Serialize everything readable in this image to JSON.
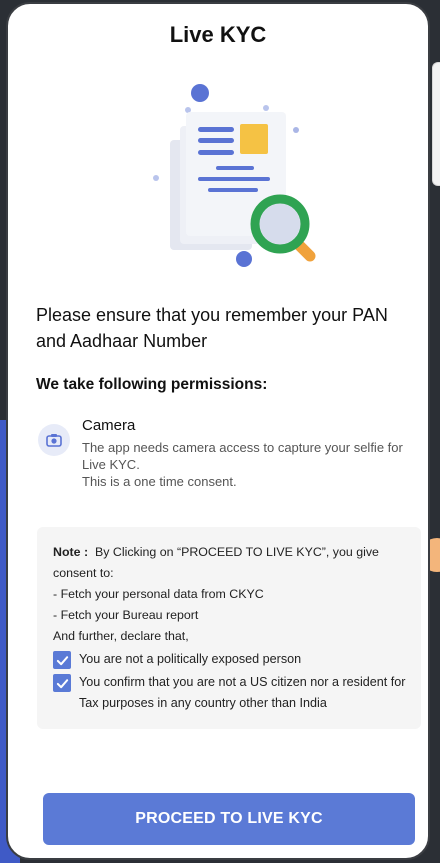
{
  "header": {
    "title": "Live KYC"
  },
  "illustration": {
    "icon": "document-search-icon"
  },
  "headline": "Please ensure that you remember your PAN and Aadhaar Number",
  "permissions": {
    "heading": "We take following permissions:",
    "camera": {
      "icon": "camera-icon",
      "title": "Camera",
      "description_line1": "The app needs camera access to capture your selfie for Live KYC.",
      "description_line2": "This is a one time consent."
    }
  },
  "note": {
    "label": "Note :",
    "text": "By Clicking on “PROCEED TO LIVE KYC”, you give consent to:",
    "item1": "- Fetch your personal data from CKYC",
    "item2": "- Fetch your Bureau report",
    "declare": "And further, declare that,",
    "checks": [
      {
        "label": "You are not a politically exposed person",
        "checked": true
      },
      {
        "label": "You confirm that you are not a US citizen nor a resident for Tax purposes in any country other than India",
        "checked": true
      }
    ]
  },
  "cta": {
    "label": "PROCEED TO LIVE KYC"
  },
  "colors": {
    "accent": "#5b7ad6",
    "note_bg": "#f5f5f5"
  }
}
